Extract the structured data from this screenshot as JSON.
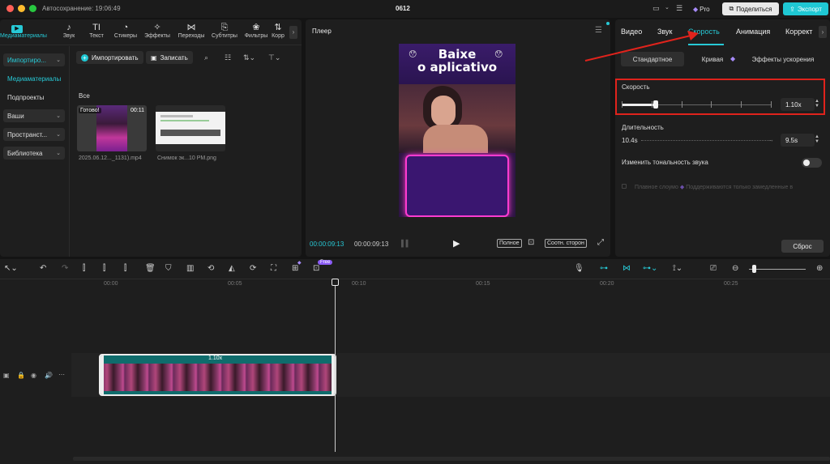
{
  "titlebar": {
    "autosave": "Автосохранение: 19:06:49",
    "title": "0612",
    "pro": "Pro",
    "share": "Поделиться",
    "export": "Экспорт"
  },
  "colors": {
    "accent": "#27c9d6",
    "export_bg": "#1fc8d4",
    "highlight_box": "#e0231c",
    "clip_bg": "#0f6c6c"
  },
  "toolbar": {
    "tools": [
      {
        "label": "Медиаматериалы",
        "icon": "media-icon"
      },
      {
        "label": "Звук",
        "icon": "sound-icon"
      },
      {
        "label": "Текст",
        "icon": "text-icon"
      },
      {
        "label": "Стикеры",
        "icon": "sticker-icon"
      },
      {
        "label": "Эффекты",
        "icon": "effects-icon"
      },
      {
        "label": "Переходы",
        "icon": "transitions-icon"
      },
      {
        "label": "Субтитры",
        "icon": "subtitles-icon"
      },
      {
        "label": "Фильтры",
        "icon": "filters-icon"
      },
      {
        "label": "Корр",
        "icon": "adjust-icon"
      }
    ]
  },
  "sidebar": {
    "items": [
      {
        "label": "Импортиро...",
        "chevron": true
      },
      {
        "label": "Медиаматериалы"
      },
      {
        "label": "Подпроекты"
      },
      {
        "label": "Ваши",
        "chevron": true
      },
      {
        "label": "Пространст...",
        "chevron": true
      },
      {
        "label": "Библиотека",
        "chevron": true
      }
    ]
  },
  "media": {
    "import_label": "Импортировать",
    "record_label": "Записать",
    "section_label": "Все",
    "items": [
      {
        "name": "2025.06.12..._1131).mp4",
        "badge": "Готово!",
        "duration": "00:11"
      },
      {
        "name": "Снимок эк...10 PM.png"
      }
    ]
  },
  "player": {
    "title": "Плеер",
    "video_text_line1": "Baixe",
    "video_text_line2": "o aplicativo",
    "time_current": "00:00:09:13",
    "time_total": "00:00:09:13",
    "full_label": "Полное",
    "ratio_label": "Соотн. сторон"
  },
  "right": {
    "tabs": [
      "Видео",
      "Звук",
      "Скорость",
      "Анимация",
      "Коррект"
    ],
    "subtabs": [
      "Стандартное",
      "Кривая",
      "Эффекты ускорения"
    ],
    "speed_label": "Скорость",
    "speed_value": "1.10x",
    "speed_fraction": 0.23,
    "duration_label": "Длительность",
    "duration_from": "10.4s",
    "duration_to": "9.5s",
    "pitch_label": "Изменить тональность звука",
    "pitch_on": false,
    "smooth_label": "Плавное слоумо",
    "smooth_note": "Поддерживаются только замедленные в",
    "reset_label": "Сброс"
  },
  "timeline": {
    "free_badge": "Free",
    "ruler": [
      "00:00",
      "00:05",
      "00:10",
      "00:15",
      "00:20",
      "00:25"
    ],
    "clip_speed": "1.10x"
  }
}
